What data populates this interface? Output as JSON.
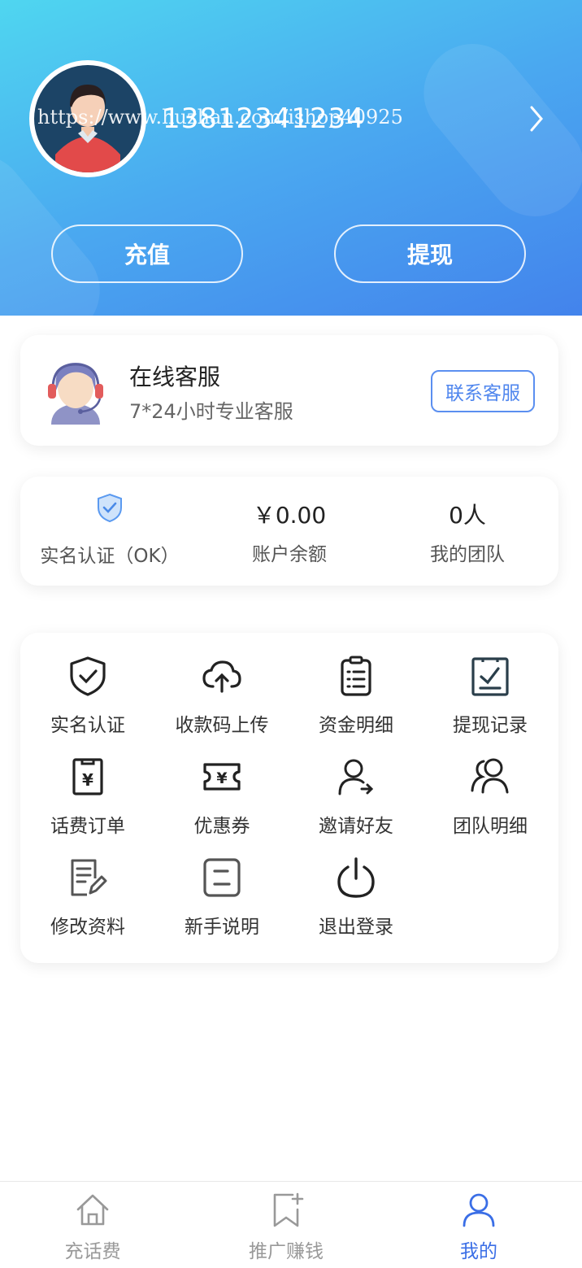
{
  "user": {
    "phone": "13812341234",
    "watermark": "https://www.huzhan.com/ishop40925"
  },
  "header_actions": {
    "recharge": "充值",
    "withdraw": "提现"
  },
  "service": {
    "title": "在线客服",
    "subtitle": "7*24小时专业客服",
    "button": "联系客服"
  },
  "stats": [
    {
      "value": "",
      "label": "实名认证（OK）",
      "icon": "verified-shield-icon"
    },
    {
      "value": "￥0.00",
      "label": "账户余额"
    },
    {
      "value": "0人",
      "label": "我的团队"
    }
  ],
  "menu": [
    {
      "label": "实名认证",
      "icon": "shield-check-icon"
    },
    {
      "label": "收款码上传",
      "icon": "cloud-upload-icon"
    },
    {
      "label": "资金明细",
      "icon": "clipboard-list-icon"
    },
    {
      "label": "提现记录",
      "icon": "clipboard-check-icon"
    },
    {
      "label": "话费订单",
      "icon": "yuan-bill-icon"
    },
    {
      "label": "优惠券",
      "icon": "coupon-icon"
    },
    {
      "label": "邀请好友",
      "icon": "invite-user-icon"
    },
    {
      "label": "团队明细",
      "icon": "team-icon"
    },
    {
      "label": "修改资料",
      "icon": "edit-document-icon"
    },
    {
      "label": "新手说明",
      "icon": "guide-icon"
    },
    {
      "label": "退出登录",
      "icon": "power-icon"
    }
  ],
  "tabs": [
    {
      "label": "充话费",
      "icon": "home-icon"
    },
    {
      "label": "推广赚钱",
      "icon": "bookmark-plus-icon"
    },
    {
      "label": "我的",
      "icon": "user-icon"
    }
  ],
  "colors": {
    "accent": "#3a6ee6",
    "header_start": "#4fd6f0",
    "header_end": "#4383ec"
  }
}
